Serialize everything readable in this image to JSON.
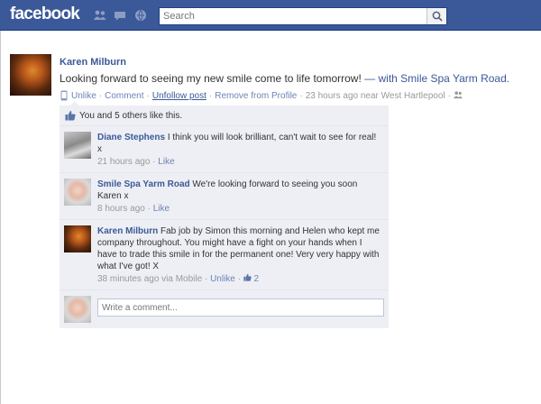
{
  "header": {
    "logo": "facebook",
    "search_placeholder": "Search",
    "colors": {
      "bar": "#3b5998",
      "link": "#3b5998"
    },
    "icons": [
      "friend-requests-icon",
      "messages-icon",
      "notifications-icon",
      "search-icon"
    ]
  },
  "post": {
    "author": "Karen Milburn",
    "message": "Looking forward to seeing my new smile come to life tomorrow!",
    "with_text": " — with Smile Spa Yarm Road.",
    "actions": {
      "unlike": "Unlike",
      "comment": "Comment",
      "unfollow": "Unfollow post",
      "remove": "Remove from Profile",
      "time": "23 hours ago near West Hartlepool"
    }
  },
  "ufi": {
    "likes": "You and 5 others like this.",
    "comments": [
      {
        "author": "Diane Stephens",
        "text": "I think you will look brilliant, can't wait to see for real! x",
        "time": "21 hours ago",
        "action": "Like"
      },
      {
        "author": "Smile Spa Yarm Road",
        "text": "We're looking forward to seeing you soon Karen x",
        "time": "8 hours ago",
        "action": "Like"
      },
      {
        "author": "Karen Milburn",
        "text": "Fab job by Simon this morning and Helen who kept me company throughout. You might have a fight on your hands when I have to trade this smile in for the permanent one! Very very happy with what I've got! X",
        "time": "38 minutes ago via Mobile",
        "action": "Unlike",
        "like_count": "2"
      }
    ],
    "write_placeholder": "Write a comment..."
  }
}
